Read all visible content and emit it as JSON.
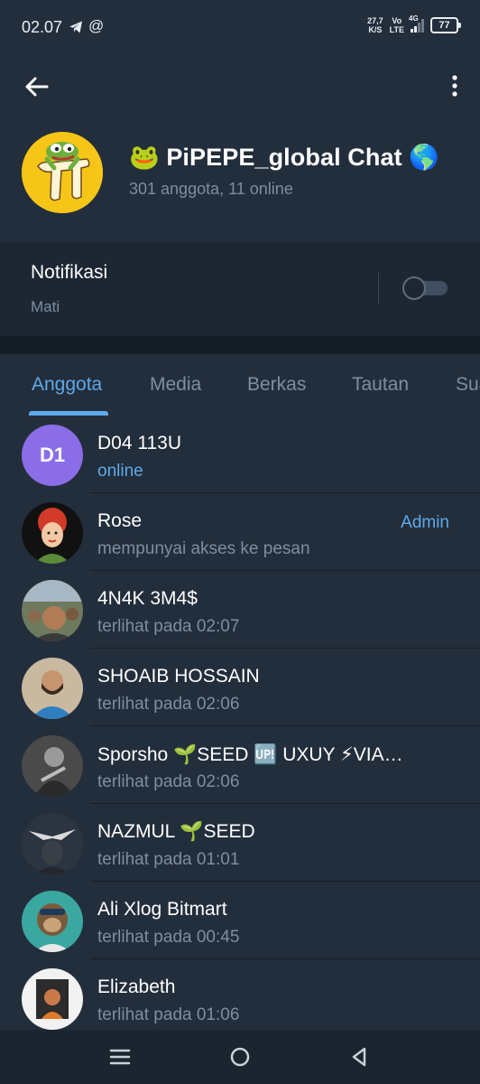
{
  "status_bar": {
    "time": "02.07",
    "at_symbol": "@",
    "net_speed_value": "27,7",
    "net_speed_unit": "K/S",
    "volte_top": "Vo",
    "volte_bottom": "LTE",
    "network": "4G",
    "battery": "77"
  },
  "header": {
    "group_title": "🐸 PiPEPE_global Chat 🌎",
    "group_subtitle": "301 anggota, 11 online"
  },
  "notifications": {
    "label": "Notifikasi",
    "value": "Mati",
    "toggle_on": false
  },
  "tabs": [
    {
      "label": "Anggota",
      "active": true
    },
    {
      "label": "Media",
      "active": false
    },
    {
      "label": "Berkas",
      "active": false
    },
    {
      "label": "Tautan",
      "active": false
    },
    {
      "label": "Sua",
      "active": false
    }
  ],
  "members": [
    {
      "name": "D04 113U",
      "status": "online",
      "initials": "D1",
      "role": ""
    },
    {
      "name": "Rose",
      "status": "mempunyai akses ke pesan",
      "role": "Admin"
    },
    {
      "name": "4N4K 3M4$",
      "status": "terlihat pada  02:07",
      "role": ""
    },
    {
      "name": "SHOAIB HOSSAIN",
      "status": "terlihat pada  02:06",
      "role": ""
    },
    {
      "name": "Sporsho 🌱SEED 🆙 UXUY ⚡VIA…",
      "status": "terlihat pada  02:06",
      "role": ""
    },
    {
      "name": "NAZMUL 🌱SEED",
      "status": "terlihat pada  01:01",
      "role": ""
    },
    {
      "name": "Ali Xlog Bitmart",
      "status": "terlihat pada  00:45",
      "role": ""
    },
    {
      "name": "Elizabeth",
      "status": "terlihat pada  01:06",
      "role": ""
    }
  ],
  "colors": {
    "background": "#232e3c",
    "accent": "#5fa9e8",
    "muted_text": "#7e8e9f"
  }
}
